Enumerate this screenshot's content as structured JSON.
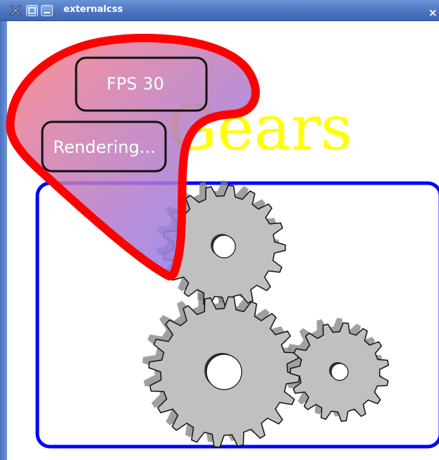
{
  "window": {
    "title": "externalcss",
    "close_glyph": "×",
    "buttons": [
      "x-icon",
      "maximize-icon",
      "minimize-icon"
    ]
  },
  "scene": {
    "title": "Gears",
    "fps_label": "FPS 30",
    "status_label": "Rendering...",
    "colors": {
      "title": "#ffff00",
      "frame": "#0000ff",
      "bubble_outline": "#ff0000",
      "gear_fill": "#c0c0c0",
      "gear_shadow": "#808080"
    }
  }
}
